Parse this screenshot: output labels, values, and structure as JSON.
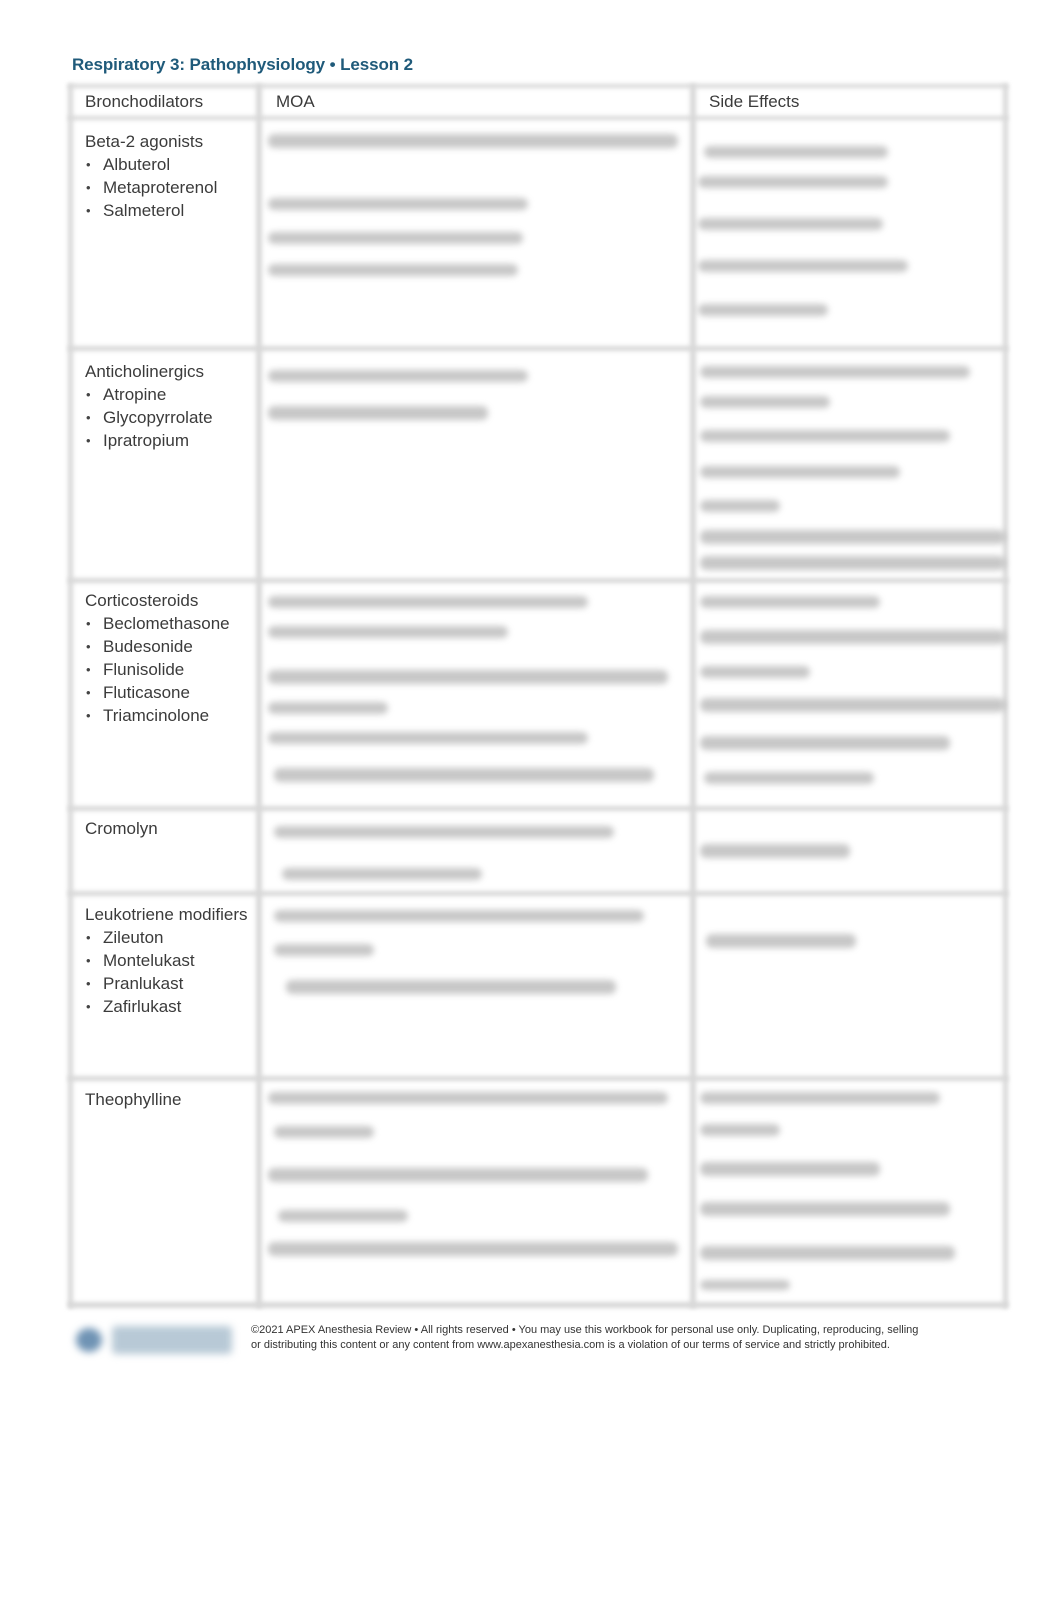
{
  "header": {
    "title": "Respiratory 3: Pathophysiology • Lesson 2"
  },
  "table": {
    "columns": [
      "Bronchodilators",
      "MOA",
      "Side Effects"
    ],
    "rows": [
      {
        "category": "Beta-2 agonists",
        "drugs": [
          "Albuterol",
          "Metaproterenol",
          "Salmeterol"
        ],
        "moa": "[handwritten, illegible]",
        "side_effects": "[handwritten, illegible]"
      },
      {
        "category": "Anticholinergics",
        "drugs": [
          "Atropine",
          "Glycopyrrolate",
          "Ipratropium"
        ],
        "moa": "[handwritten, illegible]",
        "side_effects": "[handwritten, illegible]"
      },
      {
        "category": "Corticosteroids",
        "drugs": [
          "Beclomethasone",
          "Budesonide",
          "Flunisolide",
          "Fluticasone",
          "Triamcinolone"
        ],
        "moa": "[handwritten, illegible]",
        "side_effects": "[handwritten, illegible]"
      },
      {
        "category": "Cromolyn",
        "drugs": [],
        "moa": "[handwritten, illegible]",
        "side_effects": "[handwritten, illegible]"
      },
      {
        "category": "Leukotriene modifiers",
        "drugs": [
          "Zileuton",
          "Montelukast",
          "Pranlukast",
          "Zafirlukast"
        ],
        "moa": "[handwritten, illegible]",
        "side_effects": "[handwritten, illegible]"
      },
      {
        "category": "Theophylline",
        "drugs": [],
        "moa": "[handwritten, illegible]",
        "side_effects": "[handwritten, illegible]"
      }
    ]
  },
  "footer": {
    "line1": "©2021 APEX Anesthesia Review • All rights reserved • You may use this workbook for personal use only. Duplicating, reproducing, selling",
    "line2": "or distributing this content or any content from www.apexanesthesia.com is a violation of our terms of service and strictly prohibited.",
    "logo": "apex-anesthesia-logo"
  }
}
